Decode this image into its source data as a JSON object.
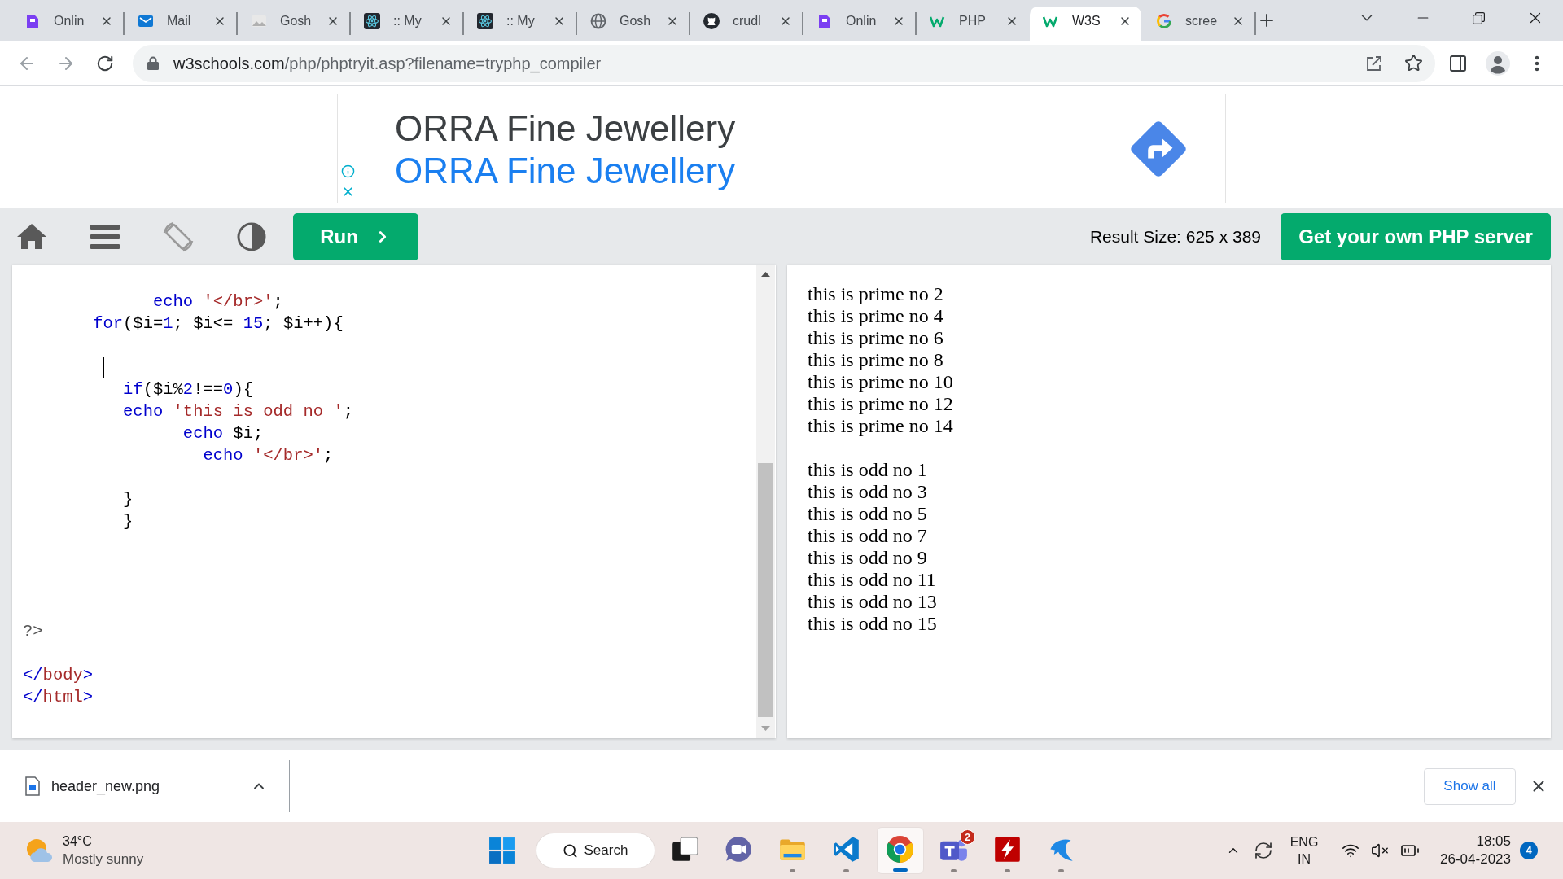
{
  "browser": {
    "tabs": [
      {
        "title": "Onlin",
        "kind": "letter",
        "selected": false
      },
      {
        "title": "Mail",
        "kind": "mail",
        "selected": false
      },
      {
        "title": "Gosh",
        "kind": "photo",
        "selected": false
      },
      {
        "title": ":: My",
        "kind": "atom",
        "selected": false
      },
      {
        "title": ":: My",
        "kind": "atom",
        "selected": false
      },
      {
        "title": "Gosh",
        "kind": "globe",
        "selected": false
      },
      {
        "title": "crudl",
        "kind": "cat",
        "selected": false
      },
      {
        "title": "Onlin",
        "kind": "letter",
        "selected": false
      },
      {
        "title": "PHP",
        "kind": "w3",
        "selected": false
      },
      {
        "title": "W3S",
        "kind": "w3",
        "selected": true
      },
      {
        "title": "scree",
        "kind": "g",
        "selected": false
      }
    ],
    "address": {
      "host": "w3schools.com",
      "path": "/php/phptryit.asp?filename=tryphp_compiler"
    }
  },
  "ad": {
    "headline": "ORRA Fine Jewellery",
    "link": "ORRA Fine Jewellery"
  },
  "toolbar": {
    "run_button": "Run",
    "result_size": "Result Size: 625 x 389",
    "server_button": "Get your own PHP server"
  },
  "editor": {
    "lines": [
      {
        "kind": "code",
        "tokens": [
          {
            "kind": "keyword",
            "text": "             echo "
          },
          {
            "kind": "string",
            "text": "'</br>'"
          },
          {
            "kind": "plain",
            "text": ";"
          }
        ]
      },
      {
        "kind": "code",
        "tokens": [
          {
            "kind": "keyword",
            "text": "       for"
          },
          {
            "kind": "plain",
            "text": "($i="
          },
          {
            "kind": "number",
            "text": "1"
          },
          {
            "kind": "plain",
            "text": "; $i<= "
          },
          {
            "kind": "number",
            "text": "15"
          },
          {
            "kind": "plain",
            "text": "; $i++){"
          }
        ]
      },
      {
        "kind": "blank"
      },
      {
        "kind": "cursor"
      },
      {
        "kind": "code",
        "tokens": [
          {
            "kind": "keyword",
            "text": "          if"
          },
          {
            "kind": "plain",
            "text": "($i%"
          },
          {
            "kind": "number",
            "text": "2"
          },
          {
            "kind": "plain",
            "text": "!=="
          },
          {
            "kind": "number",
            "text": "0"
          },
          {
            "kind": "plain",
            "text": "){"
          }
        ]
      },
      {
        "kind": "code",
        "tokens": [
          {
            "kind": "keyword",
            "text": "          echo "
          },
          {
            "kind": "string",
            "text": "'this is odd no '"
          },
          {
            "kind": "plain",
            "text": ";"
          }
        ]
      },
      {
        "kind": "code",
        "tokens": [
          {
            "kind": "keyword",
            "text": "                echo "
          },
          {
            "kind": "plain",
            "text": "$i;"
          }
        ]
      },
      {
        "kind": "code",
        "tokens": [
          {
            "kind": "keyword",
            "text": "                  echo "
          },
          {
            "kind": "string",
            "text": "'</br>'"
          },
          {
            "kind": "plain",
            "text": ";"
          }
        ]
      },
      {
        "kind": "blank"
      },
      {
        "kind": "code",
        "tokens": [
          {
            "kind": "plain",
            "text": "          }"
          }
        ]
      },
      {
        "kind": "code",
        "tokens": [
          {
            "kind": "plain",
            "text": "          }"
          }
        ]
      },
      {
        "kind": "blank"
      },
      {
        "kind": "blank"
      },
      {
        "kind": "blank"
      },
      {
        "kind": "blank"
      },
      {
        "kind": "code",
        "tokens": [
          {
            "kind": "meta",
            "text": "?>"
          }
        ]
      },
      {
        "kind": "blank"
      },
      {
        "kind": "code",
        "tokens": [
          {
            "kind": "bracket",
            "text": "</"
          },
          {
            "kind": "tag",
            "text": "body"
          },
          {
            "kind": "bracket",
            "text": ">"
          }
        ]
      },
      {
        "kind": "code",
        "tokens": [
          {
            "kind": "bracket",
            "text": "</"
          },
          {
            "kind": "tag",
            "text": "html"
          },
          {
            "kind": "bracket",
            "text": ">"
          }
        ]
      }
    ]
  },
  "result": {
    "groups": [
      {
        "lines": [
          "this is prime no 2",
          "this is prime no 4",
          "this is prime no 6",
          "this is prime no 8",
          "this is prime no 10",
          "this is prime no 12",
          "this is prime no 14"
        ]
      },
      {
        "lines": [
          "this is odd no 1",
          "this is odd no 3",
          "this is odd no 5",
          "this is odd no 7",
          "this is odd no 9",
          "this is odd no 11",
          "this is odd no 13",
          "this is odd no 15"
        ]
      }
    ]
  },
  "download_bar": {
    "file": "header_new.png",
    "show_all": "Show all"
  },
  "taskbar": {
    "weather": {
      "temperature": "34°C",
      "condition": "Mostly sunny"
    },
    "search": "Search",
    "apps": [
      {
        "kind": "taskview",
        "running": false,
        "selected": false
      },
      {
        "kind": "chat",
        "running": false,
        "selected": false
      },
      {
        "kind": "folder",
        "running": true,
        "selected": false
      },
      {
        "kind": "ribbon",
        "running": true,
        "selected": false
      },
      {
        "kind": "browser",
        "running": true,
        "selected": true
      },
      {
        "kind": "people",
        "running": true,
        "selected": false,
        "badge": "2"
      },
      {
        "kind": "bolt",
        "running": true,
        "selected": false
      },
      {
        "kind": "swoosh",
        "running": true,
        "selected": false
      }
    ],
    "language": "ENG",
    "region": "IN",
    "time": "18:05",
    "date": "26-04-2023",
    "notifications": "4"
  }
}
